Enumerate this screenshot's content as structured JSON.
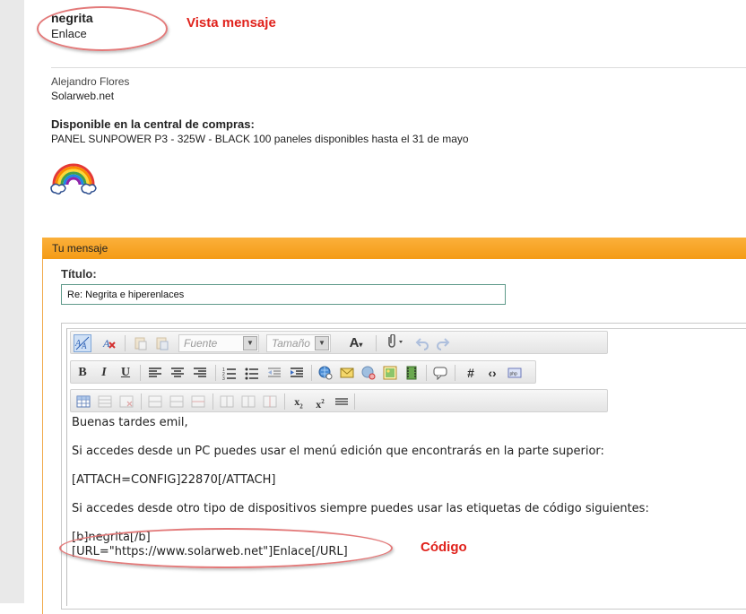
{
  "preview": {
    "bold_text": "negrita",
    "link_text": "Enlace"
  },
  "annotations": {
    "preview": "Vista mensaje",
    "code": "Código"
  },
  "signature": {
    "name": "Alejandro Flores",
    "site": "Solarweb.net",
    "heading": "Disponible en la central de compras:",
    "product": "PANEL SUNPOWER P3 - 325W - BLACK",
    "offer_rest": "100 paneles disponibles hasta el 31 de mayo"
  },
  "reply": {
    "header": "Tu mensaje",
    "title_label": "Título:",
    "title_value": "Re: Negrita e hiperenlaces"
  },
  "toolbar": {
    "font_placeholder": "Fuente",
    "size_placeholder": "Tamaño"
  },
  "editor": {
    "lines": [
      "Buenas tardes emil,",
      "",
      "Si accedes desde un PC puedes usar el menú edición que encontrarás en la parte superior:",
      "",
      "[ATTACH=CONFIG]22870[/ATTACH]",
      "",
      "Si accedes desde otro tipo de dispositivos siempre puedes usar las etiquetas de código siguientes:",
      "",
      "[b]negrita[/b]",
      "[URL=\"https://www.solarweb.net\"]Enlace[/URL]"
    ]
  },
  "colors": {
    "panel_header": "#f7a21f",
    "annotation": "#e0211b",
    "annotation_ellipse": "#e37979"
  }
}
